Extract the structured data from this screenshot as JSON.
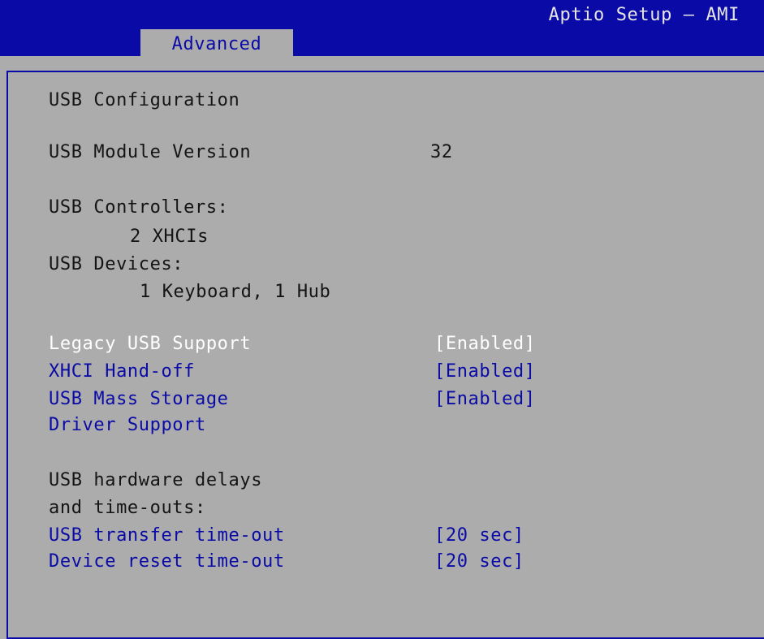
{
  "header": {
    "app_title": "Aptio Setup – AMI",
    "active_tab": "Advanced"
  },
  "section": {
    "title": "USB Configuration"
  },
  "module_version": {
    "label": "USB Module Version",
    "value": "32"
  },
  "controllers": {
    "label": "USB Controllers:",
    "value": "2 XHCIs"
  },
  "devices": {
    "label": "USB Devices:",
    "value": "1 Keyboard, 1 Hub"
  },
  "settings": [
    {
      "label": "Legacy USB Support",
      "value": "[Enabled]",
      "selected": true
    },
    {
      "label": "XHCI Hand-off",
      "value": "[Enabled]",
      "selected": false
    },
    {
      "label": "USB Mass Storage",
      "label_line2": "Driver Support",
      "value": "[Enabled]",
      "selected": false
    }
  ],
  "delays": {
    "label_line1": "USB hardware delays",
    "label_line2": "and time-outs:"
  },
  "timeouts": [
    {
      "label": "USB transfer time-out",
      "value": "[20 sec]"
    },
    {
      "label": "Device reset time-out",
      "value": "[20 sec]"
    }
  ],
  "colors": {
    "header_blue": "#0a0aa6",
    "panel_gray": "#acacac",
    "selected_text": "#ffffff",
    "option_text": "#0a0aa6"
  }
}
